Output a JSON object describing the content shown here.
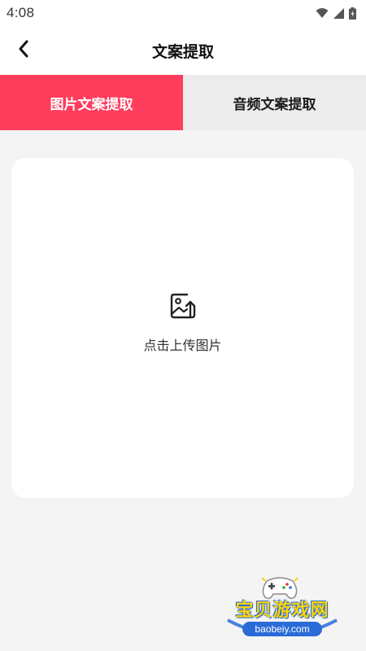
{
  "status_bar": {
    "time": "4:08",
    "icons": [
      "wifi-icon",
      "signal-icon",
      "battery-icon"
    ]
  },
  "header": {
    "back_icon": "chevron-left-icon",
    "title": "文案提取"
  },
  "tabs": [
    {
      "label": "图片文案提取",
      "active": true
    },
    {
      "label": "音频文案提取",
      "active": false
    }
  ],
  "upload": {
    "icon": "image-upload-icon",
    "label": "点击上传图片"
  },
  "watermark": {
    "title": "宝贝游戏网",
    "domain": "baobeiy.com"
  },
  "colors": {
    "accent": "#ff3d5c",
    "background": "#f4f4f4",
    "tab_inactive": "#ececec"
  }
}
